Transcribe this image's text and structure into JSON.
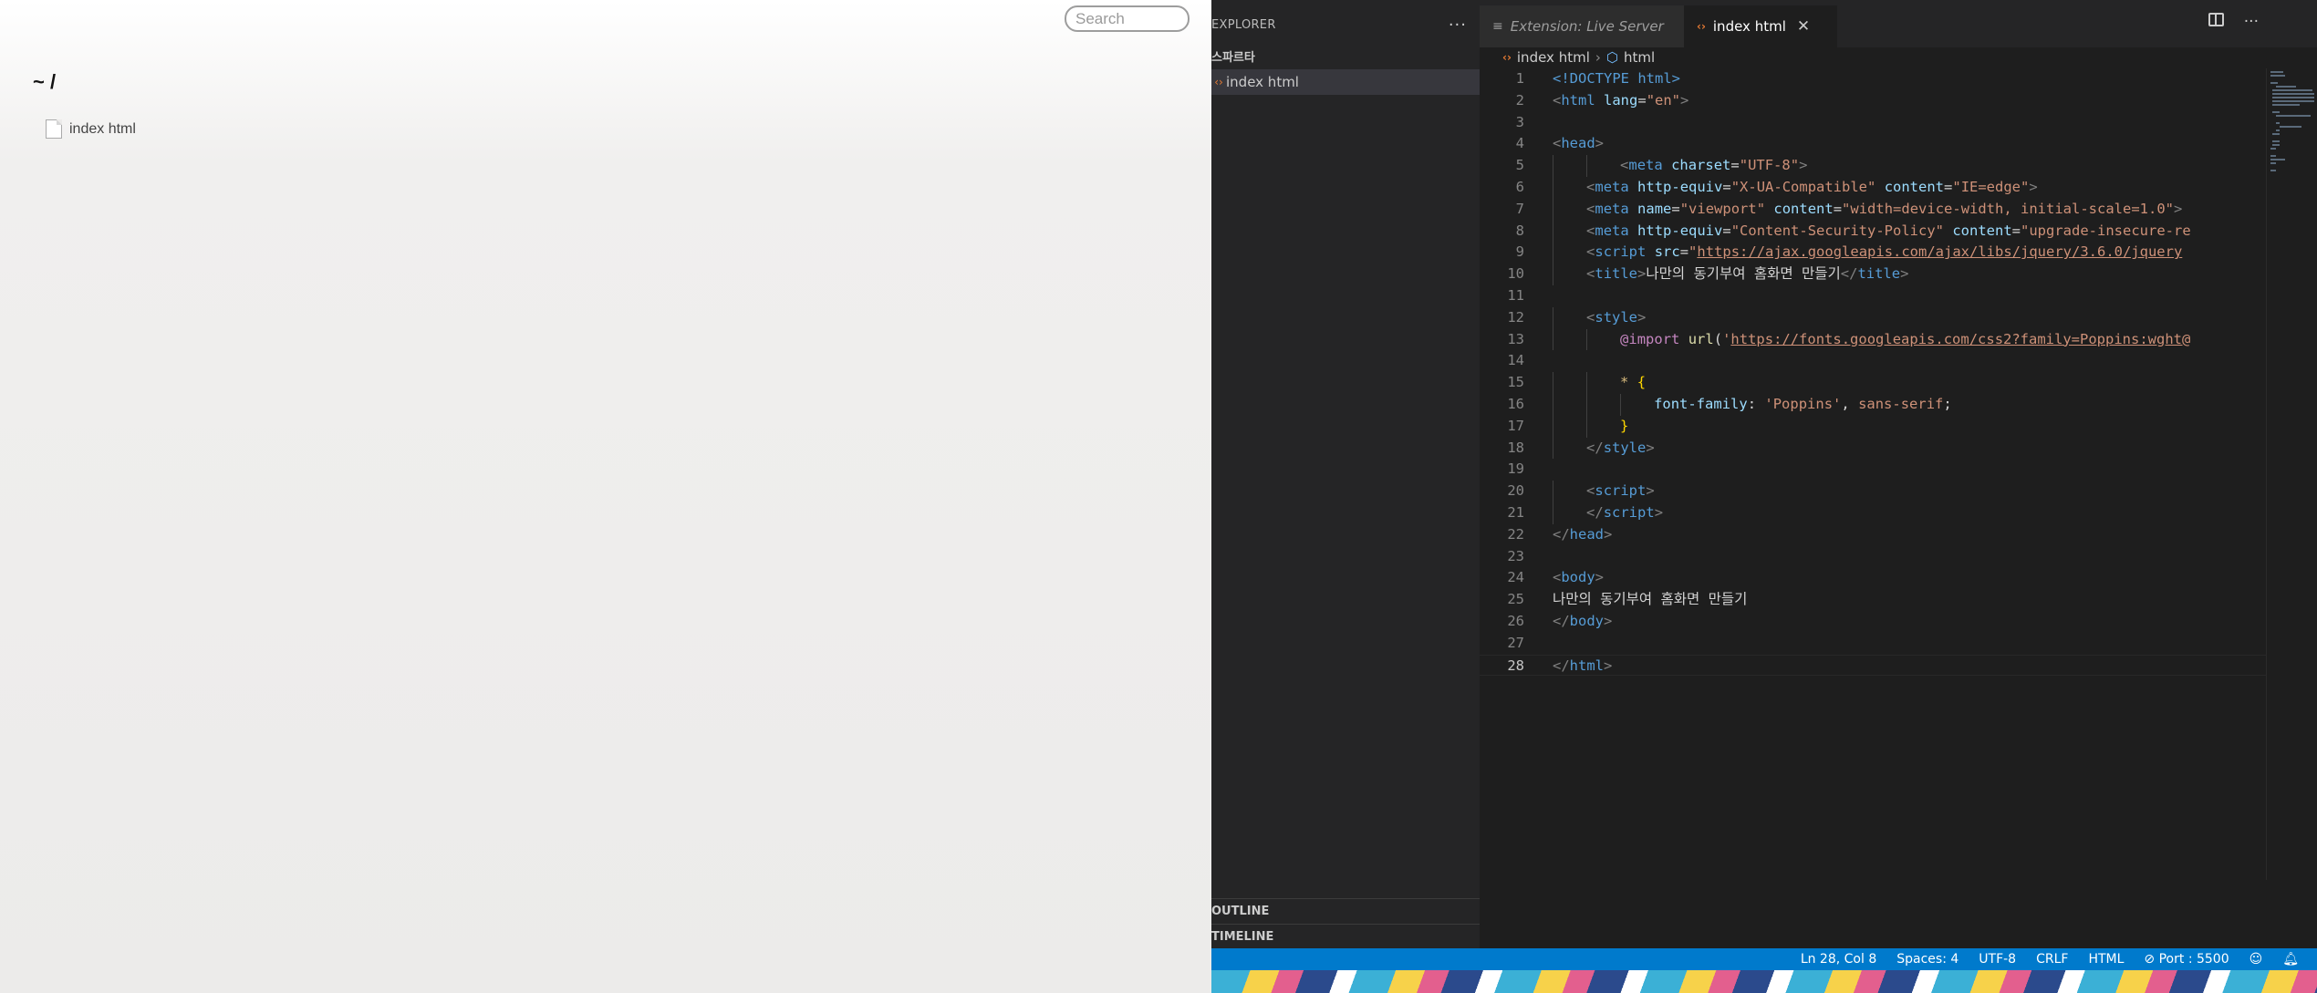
{
  "browser": {
    "search_placeholder": "Search",
    "path_title": "~ /",
    "files": [
      {
        "name": "index html"
      }
    ]
  },
  "vscode": {
    "sidebar": {
      "title": "EXPLORER",
      "more": "···",
      "folder": "스파르타",
      "tree_item": "index html",
      "outline": "OUTLINE",
      "timeline": "TIMELINE"
    },
    "tabs": [
      {
        "label": "Extension: Live Server"
      },
      {
        "label": "index html"
      }
    ],
    "breadcrumb": {
      "file": "index html",
      "symbol": "html"
    },
    "code_lines": [
      "1",
      "2",
      "3",
      "4",
      "5",
      "6",
      "7",
      "8",
      "9",
      "10",
      "11",
      "12",
      "13",
      "14",
      "15",
      "16",
      "17",
      "18",
      "19",
      "20",
      "21",
      "22",
      "23",
      "24",
      "25",
      "26",
      "27",
      "28"
    ],
    "code": {
      "l1": [
        "<!DOCTYPE ",
        "html",
        ">"
      ],
      "l2": [
        "<",
        "html",
        " ",
        "lang",
        "=",
        "\"en\"",
        ">"
      ],
      "l4": [
        "<",
        "head",
        ">"
      ],
      "l5": [
        "<",
        "meta",
        " ",
        "charset",
        "=",
        "\"UTF-8\"",
        ">"
      ],
      "l6": [
        "<",
        "meta",
        " ",
        "http-equiv",
        "=",
        "\"X-UA-Compatible\"",
        " ",
        "content",
        "=",
        "\"IE=edge\"",
        ">"
      ],
      "l7": [
        "<",
        "meta",
        " ",
        "name",
        "=",
        "\"viewport\"",
        " ",
        "content",
        "=",
        "\"width=device-width, initial-scale=1.0\"",
        ">"
      ],
      "l8": [
        "<",
        "meta",
        " ",
        "http-equiv",
        "=",
        "\"Content-Security-Policy\"",
        " ",
        "content",
        "=",
        "\"upgrade-insecure-re"
      ],
      "l9": [
        "<",
        "script",
        " ",
        "src",
        "=",
        "\"",
        "https://ajax.googleapis.com/ajax/libs/jquery/3.6.0/jquery"
      ],
      "l10": [
        "<",
        "title",
        ">",
        "나만의 동기부여 홈화면 만들기",
        "</",
        "title",
        ">"
      ],
      "l12": [
        "<",
        "style",
        ">"
      ],
      "l13": [
        "@import",
        " ",
        "url",
        "(",
        "'",
        "https://fonts.googleapis.com/css2?family=Poppins:wght@"
      ],
      "l15": [
        "*",
        " ",
        "{"
      ],
      "l16": [
        "font-family",
        ": ",
        "'Poppins'",
        ", ",
        "sans-serif",
        ";"
      ],
      "l17": [
        "}"
      ],
      "l18": [
        "</",
        "style",
        ">"
      ],
      "l20": [
        "<",
        "script",
        ">"
      ],
      "l21": [
        "</",
        "script",
        ">"
      ],
      "l22": [
        "</",
        "head",
        ">"
      ],
      "l24": [
        "<",
        "body",
        ">"
      ],
      "l25": [
        "나만의 동기부여 홈화면 만들기"
      ],
      "l26": [
        "</",
        "body",
        ">"
      ],
      "l28": [
        "</",
        "html",
        ">"
      ]
    },
    "status": {
      "position": "Ln 28, Col 8",
      "spaces": "Spaces: 4",
      "encoding": "UTF-8",
      "eol": "CRLF",
      "language": "HTML",
      "port": "Port : 5500"
    },
    "colors": {
      "accent": "#007acc",
      "tab_active": "#1e1e1e",
      "html_icon": "#e37933"
    }
  }
}
